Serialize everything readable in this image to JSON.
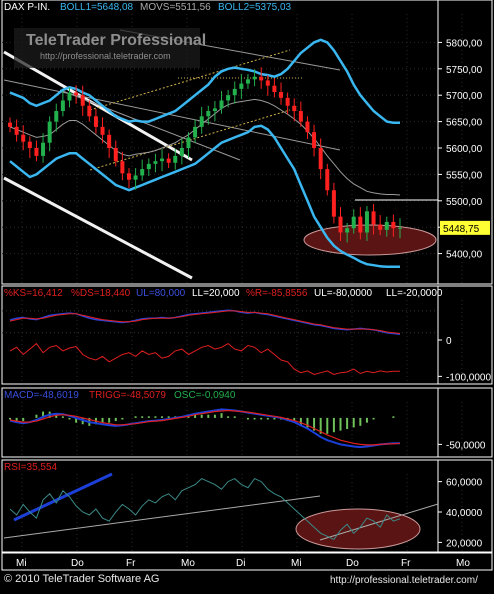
{
  "colors": {
    "bg": "#000000",
    "panel_border": "#ffffff",
    "price_axis_bg": "#000000",
    "bull_candle": "#23b14d",
    "bear_candle": "#ff2020",
    "boll": "#3ab7f0",
    "movs": "#9a9a9a",
    "rsi_line": "#3a8a88",
    "macd_line": "#1c3fd8",
    "trigger_line": "#e01f1f",
    "histogram": "#6fc15a",
    "ks_line": "#2a44d8",
    "ds_line": "#e01f1f",
    "ellipse_fill": "#5a1414",
    "trend_white": "#f2f2f2",
    "trend_blue": "#1c3fd8"
  },
  "header": {
    "instrument": "DAX P-IN.",
    "boll1": "BOLL1=5648,08",
    "movs": "MOVS=5511,56",
    "boll2": "BOLL2=5375,03"
  },
  "watermark": {
    "brand": "TeleTrader Professional",
    "url": "http://professional.teletrader.com"
  },
  "last_price_tag": "5448,75",
  "x_axis_labels": [
    "Mi",
    "Do",
    "Fr",
    "Mo",
    "Di",
    "Mi",
    "Do",
    "Fr",
    "Mo"
  ],
  "footer": {
    "copyright": "© 2010 TeleTrader Software AG",
    "url": "http://professional.teletrader.com/"
  },
  "stoch_legend": {
    "ks": "%KS=16,412",
    "ds": "%DS=18,440",
    "ul1": "UL=80,000",
    "ll1": "LL=20,000",
    "r": "%R=-85,8556",
    "ul2": "UL=-80,0000",
    "ll2": "LL=-20,0000"
  },
  "macd_legend": {
    "macd": "MACD=-48,6019",
    "trigg": "TRIGG=-48,5079",
    "osc": "OSC=-0,0940"
  },
  "rsi_legend": {
    "rsi": "RSI=35,554"
  },
  "chart_data": [
    {
      "type": "candlestick",
      "name": "price",
      "ylim": [
        5350,
        5850
      ],
      "y_ticks": [
        5400,
        5450,
        5500,
        5550,
        5600,
        5650,
        5700,
        5750,
        5800
      ],
      "y_tick_labels": [
        "5400,00",
        "5450,00",
        "5500,00",
        "5550,00",
        "5600,00",
        "5650,00",
        "5700,00",
        "5750,00",
        "5800,00"
      ],
      "last_price": 5448.75,
      "closes": [
        5640,
        5625,
        5612,
        5600,
        5585,
        5610,
        5650,
        5670,
        5690,
        5705,
        5700,
        5680,
        5660,
        5640,
        5625,
        5600,
        5575,
        5552,
        5540,
        5548,
        5560,
        5570,
        5575,
        5580,
        5572,
        5585,
        5600,
        5620,
        5640,
        5660,
        5670,
        5675,
        5690,
        5700,
        5712,
        5722,
        5730,
        5735,
        5728,
        5718,
        5706,
        5695,
        5680,
        5670,
        5650,
        5630,
        5600,
        5560,
        5520,
        5470,
        5440,
        5448,
        5470,
        5440,
        5480,
        5455,
        5445,
        5460,
        5448,
        5449
      ],
      "boll_upper": [
        5705,
        5700,
        5695,
        5685,
        5680,
        5685,
        5690,
        5700,
        5710,
        5715,
        5712,
        5705,
        5700,
        5690,
        5680,
        5670,
        5660,
        5655,
        5650,
        5652,
        5650,
        5650,
        5655,
        5660,
        5665,
        5670,
        5680,
        5690,
        5700,
        5710,
        5720,
        5735,
        5745,
        5750,
        5752,
        5750,
        5748,
        5745,
        5740,
        5738,
        5735,
        5740,
        5750,
        5765,
        5780,
        5790,
        5800,
        5805,
        5800,
        5785,
        5765,
        5745,
        5720,
        5700,
        5685,
        5670,
        5660,
        5650,
        5648,
        5648
      ],
      "boll_lower": [
        5575,
        5565,
        5555,
        5545,
        5550,
        5560,
        5570,
        5580,
        5585,
        5590,
        5590,
        5580,
        5570,
        5560,
        5550,
        5540,
        5530,
        5525,
        5520,
        5525,
        5530,
        5535,
        5540,
        5545,
        5550,
        5555,
        5560,
        5565,
        5570,
        5580,
        5590,
        5600,
        5610,
        5615,
        5620,
        5625,
        5630,
        5640,
        5642,
        5635,
        5620,
        5600,
        5580,
        5560,
        5530,
        5500,
        5470,
        5450,
        5430,
        5415,
        5405,
        5398,
        5392,
        5385,
        5380,
        5378,
        5376,
        5375,
        5375,
        5375
      ],
      "movs": [
        5640,
        5635,
        5630,
        5625,
        5620,
        5622,
        5625,
        5635,
        5645,
        5652,
        5652,
        5645,
        5635,
        5625,
        5615,
        5605,
        5595,
        5588,
        5585,
        5588,
        5590,
        5592,
        5595,
        5600,
        5605,
        5610,
        5618,
        5625,
        5635,
        5645,
        5655,
        5665,
        5675,
        5682,
        5686,
        5688,
        5690,
        5692,
        5690,
        5686,
        5680,
        5672,
        5664,
        5655,
        5645,
        5632,
        5618,
        5602,
        5585,
        5570,
        5555,
        5542,
        5532,
        5525,
        5518,
        5515,
        5513,
        5512,
        5512,
        5511
      ]
    },
    {
      "type": "line",
      "name": "stochastic",
      "ylim": [
        -110,
        110
      ],
      "y_ticks": [
        0,
        -100
      ],
      "y_tick_labels": [
        "0",
        "-100,0000"
      ],
      "series": [
        {
          "name": "%KS",
          "values": [
            55,
            60,
            62,
            58,
            56,
            62,
            68,
            70,
            72,
            74,
            72,
            66,
            60,
            56,
            54,
            52,
            50,
            48,
            50,
            54,
            58,
            60,
            60,
            62,
            60,
            62,
            66,
            70,
            72,
            74,
            76,
            78,
            80,
            82,
            80,
            76,
            74,
            76,
            72,
            70,
            66,
            62,
            58,
            54,
            50,
            46,
            42,
            40,
            36,
            32,
            30,
            28,
            30,
            32,
            30,
            28,
            24,
            20,
            18,
            16
          ]
        },
        {
          "name": "%DS",
          "values": [
            52,
            56,
            60,
            60,
            58,
            60,
            64,
            68,
            70,
            72,
            72,
            68,
            64,
            60,
            56,
            54,
            52,
            50,
            50,
            52,
            56,
            58,
            60,
            60,
            60,
            62,
            64,
            68,
            70,
            72,
            74,
            76,
            78,
            80,
            80,
            78,
            76,
            76,
            74,
            72,
            68,
            64,
            60,
            56,
            52,
            48,
            44,
            42,
            38,
            34,
            32,
            30,
            30,
            30,
            30,
            28,
            26,
            22,
            20,
            18
          ]
        },
        {
          "name": "%R",
          "values": [
            -30,
            -20,
            -40,
            -25,
            -10,
            -35,
            -20,
            -15,
            -30,
            -22,
            -18,
            -40,
            -50,
            -55,
            -45,
            -60,
            -50,
            -40,
            -35,
            -45,
            -30,
            -40,
            -35,
            -50,
            -45,
            -30,
            -25,
            -40,
            -30,
            -20,
            -15,
            -25,
            -20,
            -10,
            -25,
            -30,
            -15,
            -20,
            -35,
            -25,
            -40,
            -55,
            -60,
            -80,
            -90,
            -85,
            -95,
            -90,
            -85,
            -95,
            -90,
            -88,
            -80,
            -92,
            -86,
            -90,
            -85,
            -88,
            -86,
            -86
          ]
        }
      ]
    },
    {
      "type": "line",
      "name": "macd",
      "ylim": [
        -70,
        30
      ],
      "y_ticks": [
        -50
      ],
      "y_tick_labels": [
        "-50,0000"
      ],
      "series": [
        {
          "name": "MACD",
          "values": [
            -5,
            -8,
            -10,
            -8,
            -4,
            2,
            6,
            8,
            7,
            4,
            0,
            -4,
            -8,
            -10,
            -12,
            -14,
            -15,
            -14,
            -12,
            -10,
            -8,
            -6,
            -5,
            -4,
            -2,
            0,
            2,
            5,
            8,
            10,
            12,
            14,
            16,
            15,
            14,
            12,
            10,
            8,
            6,
            4,
            2,
            0,
            -4,
            -8,
            -14,
            -20,
            -28,
            -36,
            -42,
            -46,
            -50,
            -52,
            -54,
            -55,
            -54,
            -52,
            -50,
            -49,
            -48,
            -48
          ]
        },
        {
          "name": "TRIGG",
          "values": [
            -4,
            -6,
            -8,
            -8,
            -6,
            -2,
            2,
            5,
            6,
            5,
            3,
            0,
            -3,
            -6,
            -9,
            -11,
            -13,
            -13,
            -12,
            -11,
            -9,
            -7,
            -6,
            -5,
            -3,
            -1,
            1,
            3,
            6,
            8,
            10,
            12,
            13,
            14,
            13,
            12,
            11,
            9,
            7,
            5,
            3,
            1,
            -2,
            -5,
            -9,
            -14,
            -20,
            -26,
            -32,
            -37,
            -42,
            -45,
            -48,
            -50,
            -51,
            -51,
            -50,
            -49,
            -49,
            -48
          ]
        },
        {
          "name": "OSC",
          "values": [
            -1,
            -2,
            -2,
            0,
            2,
            4,
            4,
            3,
            1,
            -1,
            -3,
            -4,
            -5,
            -4,
            -3,
            -3,
            -2,
            -1,
            0,
            1,
            1,
            1,
            1,
            1,
            1,
            1,
            1,
            2,
            2,
            2,
            2,
            2,
            3,
            1,
            1,
            0,
            -1,
            -1,
            -1,
            -1,
            -1,
            -1,
            -2,
            -3,
            -5,
            -6,
            -8,
            -10,
            -10,
            -9,
            -8,
            -7,
            -6,
            -5,
            -3,
            -1,
            0,
            0,
            1,
            0
          ]
        }
      ]
    },
    {
      "type": "line",
      "name": "rsi",
      "ylim": [
        15,
        65
      ],
      "y_ticks": [
        20,
        40,
        60
      ],
      "y_tick_labels": [
        "20,0000",
        "40,0000",
        "60,0000"
      ],
      "series": [
        {
          "name": "RSI",
          "values": [
            42,
            38,
            45,
            40,
            36,
            48,
            52,
            46,
            54,
            50,
            44,
            40,
            38,
            42,
            36,
            34,
            40,
            45,
            42,
            38,
            44,
            48,
            46,
            50,
            52,
            48,
            54,
            56,
            58,
            62,
            60,
            58,
            55,
            60,
            62,
            58,
            56,
            62,
            60,
            55,
            52,
            50,
            46,
            42,
            38,
            34,
            30,
            26,
            24,
            22,
            28,
            32,
            26,
            30,
            36,
            34,
            30,
            38,
            34,
            35.5
          ]
        }
      ]
    }
  ]
}
